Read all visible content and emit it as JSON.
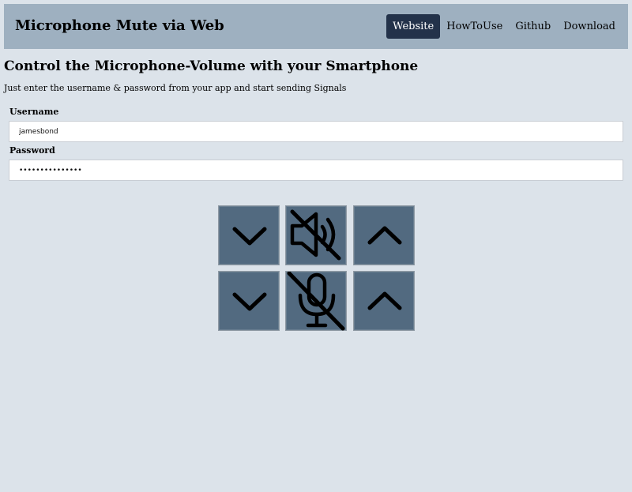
{
  "header": {
    "brand": "Microphone Mute via Web",
    "nav": [
      {
        "label": "Website",
        "active": true
      },
      {
        "label": "HowToUse",
        "active": false
      },
      {
        "label": "Github",
        "active": false
      },
      {
        "label": "Download",
        "active": false
      }
    ]
  },
  "main": {
    "title": "Control the Microphone-Volume with your Smartphone",
    "lead": "Just enter the username & password from your app and start sending Signals",
    "username": {
      "label": "Username",
      "value": "jamesbond"
    },
    "password": {
      "label": "Password",
      "value": "secretpassword1"
    }
  },
  "controls": {
    "speaker_row": [
      "chevron-down-icon",
      "speaker-muted-icon",
      "chevron-up-icon"
    ],
    "mic_row": [
      "chevron-down-icon",
      "microphone-muted-icon",
      "chevron-up-icon"
    ]
  },
  "colors": {
    "page_bg": "#dce3ea",
    "header_bg": "#9eb0c0",
    "nav_active_bg": "#23324a",
    "pad_bg": "#526a80"
  }
}
